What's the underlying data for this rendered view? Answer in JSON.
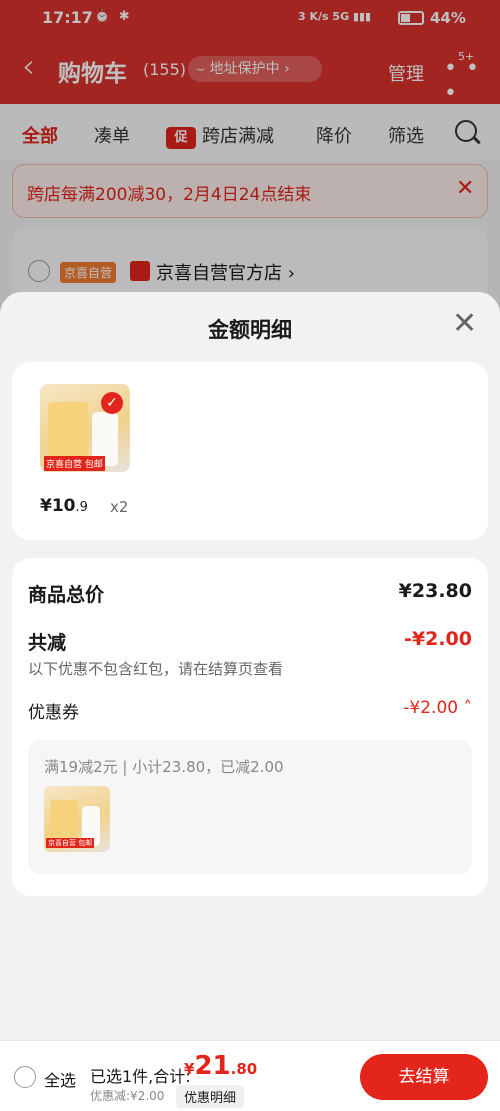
{
  "status": {
    "time": "17:17",
    "net_speed": "3 K/s",
    "signal": "5G",
    "battery": "44%",
    "battery_level": 0.44
  },
  "header": {
    "back_label": "‹",
    "title": "购物车",
    "count": "(155)",
    "address": "地址保护中 ›",
    "manage": "管理",
    "more_badge": "5+"
  },
  "tabs": [
    "全部",
    "凑单",
    "跨店满减",
    "降价",
    "筛选"
  ],
  "promo_tag": "促",
  "notice": {
    "text": "跨店每满200减30，2月4日24点结束",
    "close": "✕"
  },
  "store": {
    "tag": "京喜自营",
    "name": "京喜自营官方店 ›"
  },
  "sheet": {
    "title": "金额明细",
    "close": "✕",
    "product": {
      "pkg_label": "京喜自营 包邮",
      "price_int": "¥10",
      "price_dec": ".9",
      "qty": "x2"
    },
    "goods_total_label": "商品总价",
    "goods_total_value": "¥23.80",
    "reduce_label": "共减",
    "reduce_value": "-¥2.00",
    "reduce_note": "以下优惠不包含红包，请在结算页查看",
    "coupon_label": "优惠券",
    "coupon_value": "-¥2.00 ˄",
    "coupon_detail": "满19减2元 | 小计23.80，已减2.00"
  },
  "footer": {
    "select_all": "全选",
    "selected": "已选1件,合计:",
    "total_cur": "¥",
    "total_int": "21",
    "total_dec": ".80",
    "discount": "优惠减:¥2.00",
    "detail_btn": "优惠明细",
    "checkout": "去结算"
  },
  "colors": {
    "brand_red": "#d8322c",
    "accent_red": "#e1251b"
  }
}
